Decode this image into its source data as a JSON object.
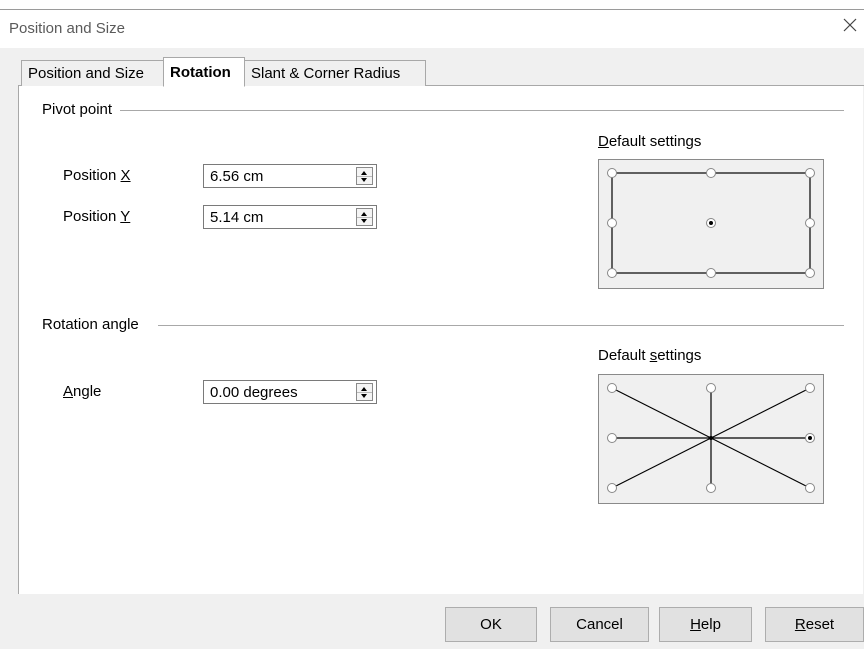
{
  "window": {
    "title": "Position and Size"
  },
  "tabs": [
    {
      "label": "Position and Size",
      "active": false
    },
    {
      "label": "Rotation",
      "active": true
    },
    {
      "label": "Slant & Corner Radius",
      "active": false
    }
  ],
  "pivot": {
    "section_label": "Pivot point",
    "position_x_label_pre": "Position ",
    "position_x_label_accel": "X",
    "position_x_value": "6.56 cm",
    "position_y_label_pre": "Position ",
    "position_y_label_accel": "Y",
    "position_y_value": "5.14 cm",
    "default_settings_accel": "D",
    "default_settings_rest": "efault settings"
  },
  "rotation": {
    "section_label": "Rotation angle",
    "angle_label_accel": "A",
    "angle_label_rest": "ngle",
    "angle_value": "0.00 degrees",
    "default_settings_pre": "Default ",
    "default_settings_accel": "s",
    "default_settings_rest": "ettings"
  },
  "buttons": {
    "ok": "OK",
    "cancel": "Cancel",
    "help_accel": "H",
    "help_rest": "elp",
    "reset_accel": "R",
    "reset_rest": "eset"
  },
  "icons": {
    "close": "close-icon",
    "spin_up": "spin-up-icon",
    "spin_down": "spin-down-icon"
  },
  "colors": {
    "dialog_bg": "#f0f0f0",
    "panel_bg": "#ffffff",
    "border": "#a8a8a8",
    "button_bg": "#e1e1e1"
  }
}
